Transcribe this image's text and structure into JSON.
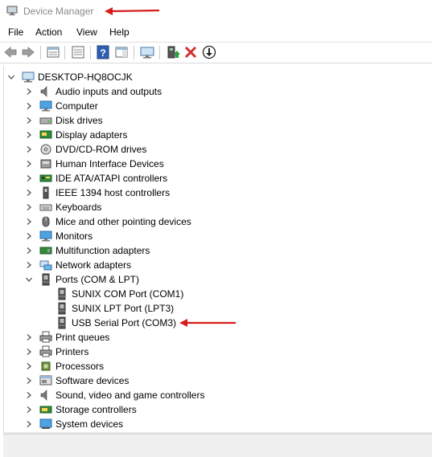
{
  "window": {
    "title": "Device Manager"
  },
  "menu": [
    {
      "label": "File"
    },
    {
      "label": "Action"
    },
    {
      "label": "View"
    },
    {
      "label": "Help"
    }
  ],
  "toolbar": [
    {
      "icon": "back-icon"
    },
    {
      "icon": "forward-icon"
    },
    {
      "icon": "properties-icon"
    },
    {
      "icon": "show-hide-icon"
    },
    {
      "icon": "help-icon"
    },
    {
      "icon": "action-pane-icon"
    },
    {
      "icon": "scan-hardware-icon"
    },
    {
      "icon": "update-driver-icon"
    },
    {
      "icon": "uninstall-icon"
    },
    {
      "icon": "disable-device-icon"
    }
  ],
  "tree": {
    "root": {
      "label": "DESKTOP-HQ8OCJK",
      "expanded": true
    },
    "categories": [
      {
        "label": "Audio inputs and outputs",
        "icon": "speaker-icon",
        "expanded": false
      },
      {
        "label": "Computer",
        "icon": "monitor-icon",
        "expanded": false
      },
      {
        "label": "Disk drives",
        "icon": "disk-icon",
        "expanded": false
      },
      {
        "label": "Display adapters",
        "icon": "display-adapter-icon",
        "expanded": false
      },
      {
        "label": "DVD/CD-ROM drives",
        "icon": "dvd-icon",
        "expanded": false
      },
      {
        "label": "Human Interface Devices",
        "icon": "hid-icon",
        "expanded": false
      },
      {
        "label": "IDE ATA/ATAPI controllers",
        "icon": "ide-icon",
        "expanded": false
      },
      {
        "label": "IEEE 1394 host controllers",
        "icon": "ieee-icon",
        "expanded": false
      },
      {
        "label": "Keyboards",
        "icon": "keyboard-icon",
        "expanded": false
      },
      {
        "label": "Mice and other pointing devices",
        "icon": "mouse-icon",
        "expanded": false
      },
      {
        "label": "Monitors",
        "icon": "monitor-icon",
        "expanded": false
      },
      {
        "label": "Multifunction adapters",
        "icon": "multifunction-icon",
        "expanded": false
      },
      {
        "label": "Network adapters",
        "icon": "network-icon",
        "expanded": false
      },
      {
        "label": "Ports (COM & LPT)",
        "icon": "port-icon",
        "expanded": true,
        "children": [
          {
            "label": "SUNIX COM Port (COM1)",
            "icon": "port-icon"
          },
          {
            "label": "SUNIX LPT Port (LPT3)",
            "icon": "port-icon"
          },
          {
            "label": "USB Serial Port (COM3)",
            "icon": "port-icon"
          }
        ]
      },
      {
        "label": "Print queues",
        "icon": "printer-icon",
        "expanded": false
      },
      {
        "label": "Printers",
        "icon": "printer-icon",
        "expanded": false
      },
      {
        "label": "Processors",
        "icon": "processor-icon",
        "expanded": false
      },
      {
        "label": "Software devices",
        "icon": "software-device-icon",
        "expanded": false
      },
      {
        "label": "Sound, video and game controllers",
        "icon": "speaker-icon",
        "expanded": false
      },
      {
        "label": "Storage controllers",
        "icon": "storage-icon",
        "expanded": false
      },
      {
        "label": "System devices",
        "icon": "system-icon",
        "expanded": false
      }
    ]
  },
  "colors": {
    "annotation_arrow": "#d81b1b",
    "title_text": "#8a8a8a",
    "chevron": "#555555"
  }
}
